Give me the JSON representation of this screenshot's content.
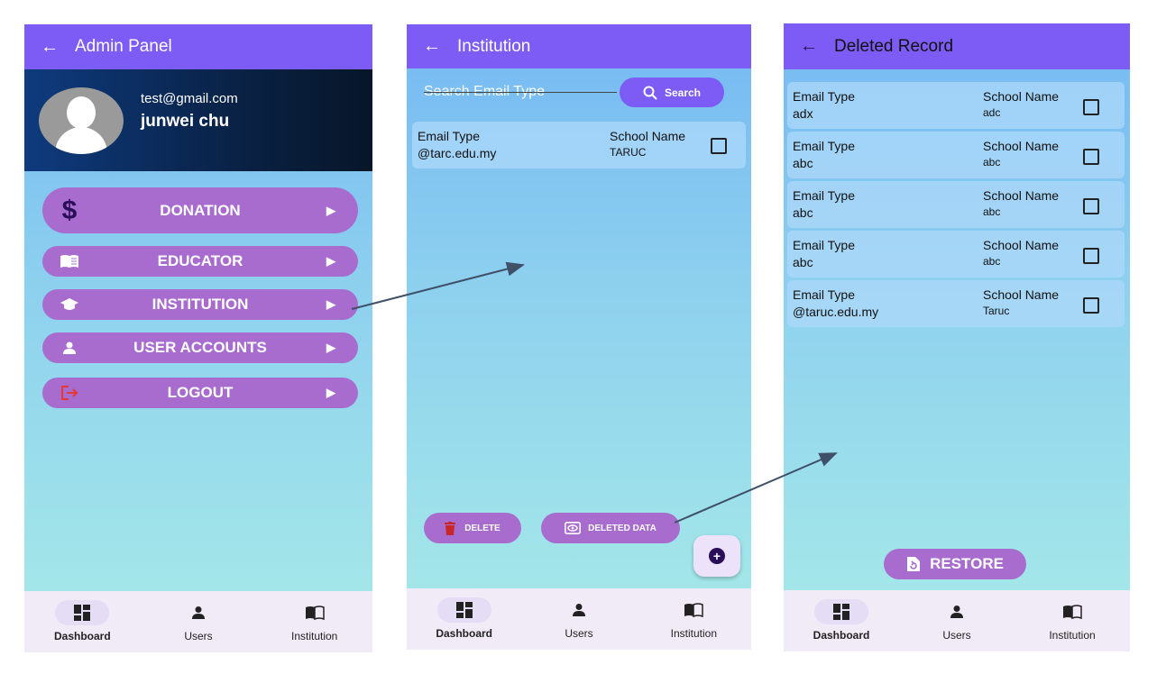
{
  "admin_panel": {
    "title": "Admin Panel",
    "back_icon": "arrow-left-icon",
    "email": "test@gmail.com",
    "username": "junwei chu",
    "menu": [
      {
        "label": "DONATION",
        "icon": "dollar-icon"
      },
      {
        "label": "EDUCATOR",
        "icon": "book-icon"
      },
      {
        "label": "INSTITUTION",
        "icon": "school-icon"
      },
      {
        "label": "USER ACCOUNTS",
        "icon": "person-icon"
      },
      {
        "label": "LOGOUT",
        "icon": "logout-icon"
      }
    ]
  },
  "institution": {
    "title": "Institution",
    "search_placeholder": "Search Email Type",
    "search_label": "Search",
    "record": {
      "email_label": "Email Type",
      "email_value": "@tarc.edu.my",
      "school_label": "School Name",
      "school_value": "TARUC"
    },
    "delete_label": "DELETE",
    "deleted_data_label": "DELETED DATA"
  },
  "deleted_record": {
    "title": "Deleted Record",
    "records": [
      {
        "email_label": "Email Type",
        "email_value": "adx",
        "school_label": "School Name",
        "school_value": "adc"
      },
      {
        "email_label": "Email Type",
        "email_value": "abc",
        "school_label": "School Name",
        "school_value": "abc"
      },
      {
        "email_label": "Email Type",
        "email_value": "abc",
        "school_label": "School Name",
        "school_value": "abc"
      },
      {
        "email_label": "Email Type",
        "email_value": "abc",
        "school_label": "School Name",
        "school_value": "abc"
      },
      {
        "email_label": "Email Type",
        "email_value": "@taruc.edu.my",
        "school_label": "School Name",
        "school_value": "Taruc"
      }
    ],
    "restore_label": "RESTORE"
  },
  "nav": {
    "dashboard": "Dashboard",
    "users": "Users",
    "institution": "Institution"
  },
  "colors": {
    "appbar": "#7c5cf5",
    "menu_button": "#a86ccf",
    "logout_icon": "#e53935",
    "delete_icon": "#c62828"
  }
}
